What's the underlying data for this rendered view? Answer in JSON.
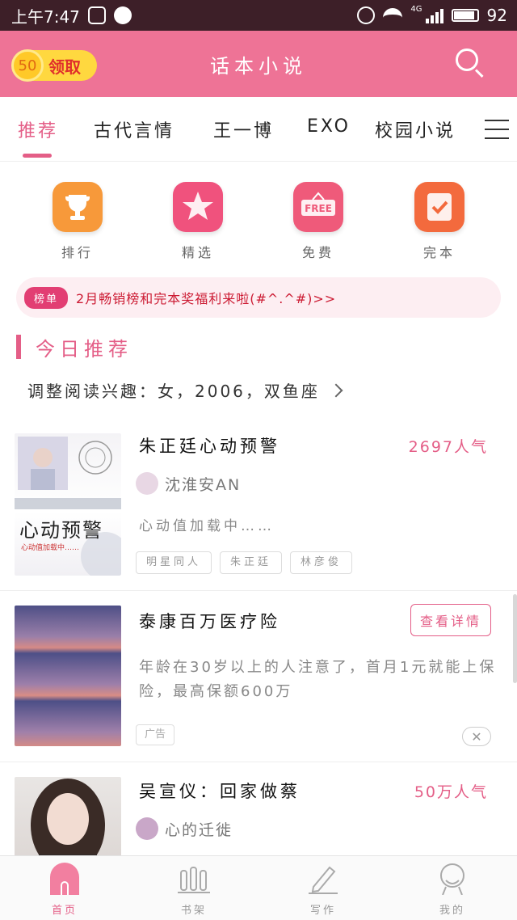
{
  "status_bar": {
    "time": "上午7:47",
    "network": "4G",
    "battery": "92"
  },
  "header": {
    "coin_amount": "50",
    "coin_label": "领取",
    "title": "话本小说"
  },
  "tabs": [
    {
      "label": "推荐",
      "active": true
    },
    {
      "label": "古代言情",
      "active": false
    },
    {
      "label": "王一博",
      "active": false
    },
    {
      "label": "EXO",
      "active": false
    },
    {
      "label": "校园小说",
      "active": false
    }
  ],
  "quick_entries": [
    {
      "label": "排行",
      "icon": "trophy-icon",
      "color": "#f7993a"
    },
    {
      "label": "精选",
      "icon": "star-icon",
      "color": "#f0527d"
    },
    {
      "label": "免费",
      "icon": "free-icon",
      "color": "#ef5a7a"
    },
    {
      "label": "完本",
      "icon": "check-icon",
      "color": "#f36a3d"
    }
  ],
  "banner": {
    "badge": "榜单",
    "text": "2月畅销榜和完本奖福利来啦(#^.^#)>>"
  },
  "section": {
    "title": "今日推荐",
    "interest_text": "调整阅读兴趣：女，2006，双鱼座"
  },
  "books": [
    {
      "title": "朱正廷心动预警",
      "popularity": "2697人气",
      "author": "沈淮安AN",
      "description": "心动值加载中……",
      "tags": [
        "明星同人",
        "朱正廷",
        "林彦俊"
      ],
      "cover_text": "心动预警",
      "cover_sub": "心动值加载中……"
    },
    {
      "title": "吴宣仪：回家做蔡",
      "popularity": "50万人气",
      "author": "心的迁徙"
    }
  ],
  "ad": {
    "title": "泰康百万医疗险",
    "button": "查看详情",
    "description": "年龄在30岁以上的人注意了，首月1元就能上保险，最高保额600万",
    "tag": "广告",
    "close": "✕"
  },
  "bottom_nav": [
    {
      "label": "首页",
      "icon": "home-icon",
      "active": true
    },
    {
      "label": "书架",
      "icon": "bookshelf-icon",
      "active": false
    },
    {
      "label": "写作",
      "icon": "pen-icon",
      "active": false
    },
    {
      "label": "我的",
      "icon": "profile-icon",
      "active": false
    }
  ],
  "colors": {
    "accent": "#e45e87",
    "header_bg": "#ee7396",
    "status_bg": "#3d1f28"
  }
}
